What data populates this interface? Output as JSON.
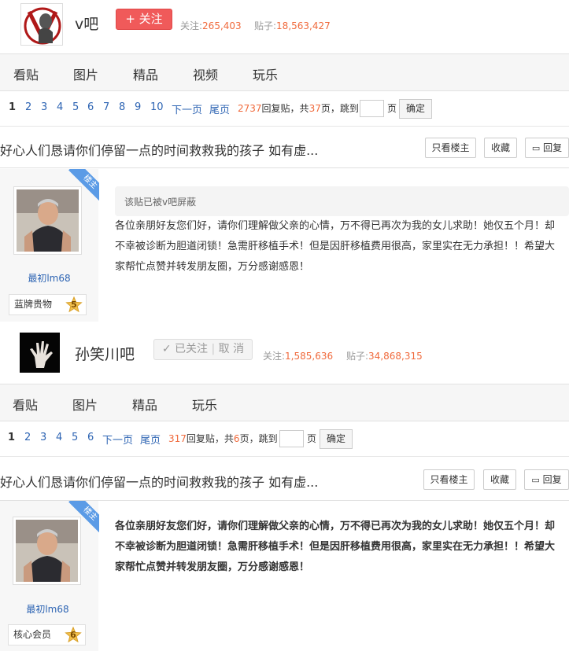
{
  "forum1": {
    "name": "v吧",
    "follow_label": "+ 关注",
    "follow_stat_label": "关注:",
    "follow_count": "265,403",
    "post_stat_label": "贴子:",
    "post_count": "18,563,427"
  },
  "nav1": [
    "看贴",
    "图片",
    "精品",
    "视频",
    "玩乐"
  ],
  "pager1": {
    "pages": [
      "1",
      "2",
      "3",
      "4",
      "5",
      "6",
      "7",
      "8",
      "9",
      "10"
    ],
    "next": "下一页",
    "last": "尾页",
    "reply_count": "2737",
    "reply_text": "回复贴，共",
    "page_total": "37",
    "page_text": "页，跳到",
    "page_unit": "页",
    "ok": "确定"
  },
  "thread1": {
    "title": "好心人们恳请你们停留一点的时间救救我的孩子 如有虚...",
    "only_op": "只看楼主",
    "favorite": "收藏",
    "reply": "回复"
  },
  "post1": {
    "ribbon": "楼主",
    "author": "最初lm68",
    "badge": "蓝牌贵物",
    "level": "5",
    "blocked": "该贴已被v吧屏蔽",
    "body": "各位亲朋好友您们好，请你们理解做父亲的心情，万不得已再次为我的女儿求助！她仅五个月！却不幸被诊断为胆道闭锁！急需肝移植手术！但是因肝移植费用很高，家里实在无力承担！！希望大家帮忙点赞并转发朋友圈，万分感谢感恩！"
  },
  "forum2": {
    "name": "孙笑川吧",
    "followed_label": "已关注",
    "unfollow_label": "取 消",
    "follow_stat_label": "关注:",
    "follow_count": "1,585,636",
    "post_stat_label": "贴子:",
    "post_count": "34,868,315"
  },
  "nav2": [
    "看贴",
    "图片",
    "精品",
    "玩乐"
  ],
  "pager2": {
    "pages": [
      "1",
      "2",
      "3",
      "4",
      "5",
      "6"
    ],
    "next": "下一页",
    "last": "尾页",
    "reply_count": "317",
    "reply_text": "回复贴，共",
    "page_total": "6",
    "page_text": "页，跳到",
    "page_unit": "页",
    "ok": "确定"
  },
  "thread2": {
    "title": "好心人们恳请你们停留一点的时间救救我的孩子 如有虚...",
    "only_op": "只看楼主",
    "favorite": "收藏",
    "reply": "回复"
  },
  "post2": {
    "ribbon": "楼主",
    "author": "最初lm68",
    "badge": "核心会员",
    "level": "6",
    "body": "各位亲朋好友您们好，请你们理解做父亲的心情，万不得已再次为我的女儿求助！她仅五个月！却不幸被诊断为胆道闭锁！急需肝移植手术！但是因肝移植费用很高，家里实在无力承担！！希望大家帮忙点赞并转发朋友圈，万分感谢感恩！"
  }
}
